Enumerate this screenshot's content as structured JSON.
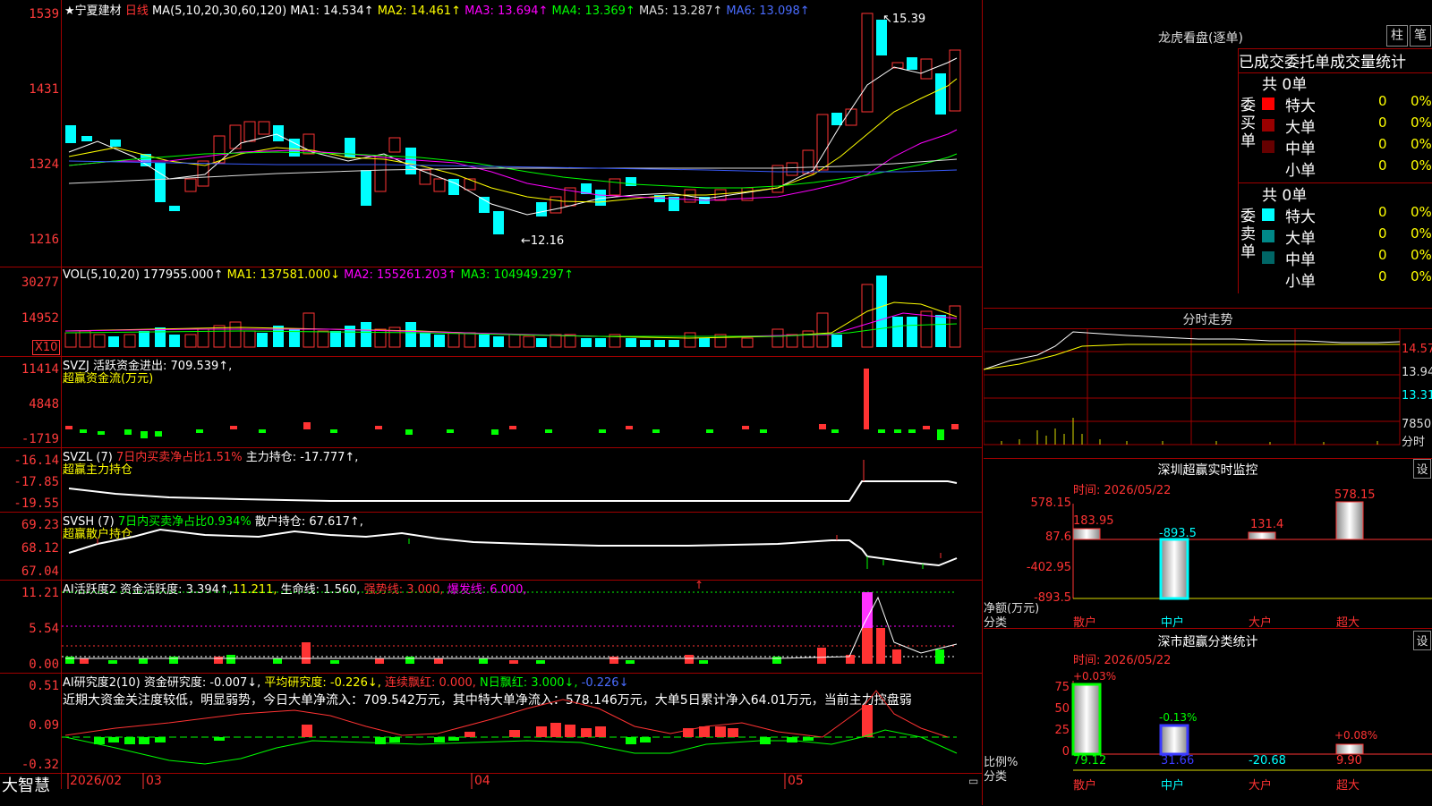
{
  "stock": {
    "star": "★",
    "name": "宁夏建材",
    "period": "日线"
  },
  "kline": {
    "ma_header": "MA(5,10,20,30,60,120)",
    "ma1": "MA1: 14.534↑",
    "ma2": "MA2: 14.461↑",
    "ma3": "MA3: 13.694↑",
    "ma4": "MA4: 13.369↑",
    "ma5": "MA5: 13.287↑",
    "ma6": "MA6: 13.098↑",
    "y_labels": [
      "1539",
      "1431",
      "1324",
      "1216"
    ],
    "high_mark": "15.39",
    "low_mark": "12.16"
  },
  "vol": {
    "header": "VOL(5,10,20)",
    "value": "177955.000↑",
    "ma1": "MA1: 137581.000↓",
    "ma2": "MA2: 155261.203↑",
    "ma3": "MA3: 104949.297↑",
    "y_labels": [
      "30277",
      "14952"
    ],
    "unit": "X10"
  },
  "svzj": {
    "header": "SVZJ  活跃资金进出: 709.539↑,",
    "sub": "超赢资金流(万元)",
    "y_labels": [
      "11414",
      "4848",
      "-1719"
    ]
  },
  "svzl": {
    "header_a": "SVZL (7)",
    "header_b": "7日内买卖净占比1.51%",
    "header_c": "主力持仓: -17.777↑,",
    "sub": "超赢主力持仓",
    "y_labels": [
      "-16.14",
      "-17.85",
      "-19.55"
    ]
  },
  "svsh": {
    "header_a": "SVSH (7)",
    "header_b": "7日内买卖净占比0.934%",
    "header_c": "散户持仓: 67.617↑,",
    "sub": "超赢散户持仓",
    "y_labels": [
      "69.23",
      "68.12",
      "67.04"
    ]
  },
  "ai_active": {
    "header_a": "AI活跃度2",
    "header_b": "资金活跃度: 3.394↑,",
    "header_c": "11.211,",
    "header_d": "生命线: 1.560,",
    "header_e": "强势线: 3.000,",
    "header_f": "爆发线: 6.000,",
    "y_labels": [
      "11.21",
      "5.54",
      "0.00"
    ]
  },
  "ai_research": {
    "header_a": "AI研究度2(10)",
    "header_b": "资金研究度: -0.007↓,",
    "header_c": "平均研究度: -0.226↓,",
    "header_d": "连续飘红: 0.000,",
    "header_e": "N日飘红: 3.000↓,",
    "header_f": "-0.226↓",
    "comment": "近期大资金关注度较低，明显弱势，今日大单净流入：709.542万元，其中特大单净流入：578.146万元，大单5日累计净入64.01万元，当前主力控盘弱",
    "y_labels": [
      "0.51",
      "0.09",
      "-0.32"
    ]
  },
  "bottom_axis": {
    "brand": "大智慧",
    "dates": [
      "2026/02",
      "03",
      "04",
      "05"
    ]
  },
  "right": {
    "top_buttons": [
      "柱",
      "笔"
    ],
    "lhb_title": "龙虎看盘(逐单)",
    "tabs": [
      "已成交",
      "委托单",
      "成交量",
      "统计"
    ],
    "buy": {
      "side": "委买单",
      "total": "共 0单",
      "rows": [
        {
          "name": "特大",
          "count": "0",
          "pct": "0%",
          "color": "#ff0000"
        },
        {
          "name": "大单",
          "count": "0",
          "pct": "0%",
          "color": "#990000"
        },
        {
          "name": "中单",
          "count": "0",
          "pct": "0%",
          "color": "#660000"
        },
        {
          "name": "小单",
          "count": "0",
          "pct": "0%",
          "color": ""
        }
      ]
    },
    "sell": {
      "side": "委卖单",
      "total": "共 0单",
      "rows": [
        {
          "name": "特大",
          "count": "0",
          "pct": "0%",
          "color": "#00ffff"
        },
        {
          "name": "大单",
          "count": "0",
          "pct": "0%",
          "color": "#008888"
        },
        {
          "name": "中单",
          "count": "0",
          "pct": "0%",
          "color": "#006666"
        },
        {
          "name": "小单",
          "count": "0",
          "pct": "0%",
          "color": ""
        }
      ]
    },
    "intraday": {
      "title": "分时走势",
      "y_labels": [
        "14.57",
        "13.94",
        "13.31"
      ],
      "vol_label": "7850",
      "vol_unit": "分时"
    },
    "monitor": {
      "title": "深圳超赢实时监控",
      "set": "设",
      "time": "时间: 2026/05/22",
      "y_labels": [
        "578.15",
        "87.6",
        "-402.95",
        "-893.5"
      ],
      "y_title": "净额(万元)",
      "x_title": "分类",
      "categories": [
        "散户",
        "中户",
        "大户",
        "超大"
      ],
      "values": [
        "183.95",
        "-893.5",
        "131.4",
        "578.15"
      ]
    },
    "classify": {
      "title": "深市超赢分类统计",
      "set": "设",
      "time": "时间: 2026/05/22",
      "y_labels": [
        "75",
        "50",
        "25",
        "0"
      ],
      "y_title": "比例%",
      "x_title": "分类",
      "categories": [
        "散户",
        "中户",
        "大户",
        "超大"
      ],
      "top_values": [
        "+0.03%",
        "-0.13%",
        "",
        "+0.08%"
      ],
      "bottom_values": [
        "79.12",
        "31.66",
        "-20.68",
        "9.90"
      ]
    }
  }
}
